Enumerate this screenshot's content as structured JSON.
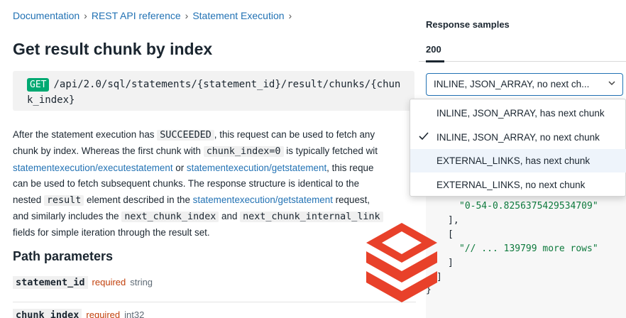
{
  "breadcrumb": {
    "items": [
      "Documentation",
      "REST API reference",
      "Statement Execution"
    ],
    "separator": "›"
  },
  "page": {
    "title": "Get result chunk by index"
  },
  "endpoint": {
    "method": "GET",
    "path_line1": "/api/2.0/sql/statements/{statement_id}/result/chunks/{chun",
    "path_line2": "k_index}"
  },
  "description": {
    "l1a": "After the statement execution has ",
    "l1code": "SUCCEEDED",
    "l1b": ", this request can be used to fetch any",
    "l2a": "chunk by index. Whereas the first chunk with ",
    "l2code": "chunk_index=0",
    "l2b": " is typically fetched wit",
    "l3link1": "statementexecution/executestatement",
    "l3a": " or ",
    "l3link2": "statementexecution/getstatement",
    "l3b": ", this reque",
    "l4": "can be used to fetch subsequent chunks. The response structure is identical to the",
    "l5a": "nested ",
    "l5code": "result",
    "l5b": " element described in the ",
    "l5link": "statementexecution/getstatement",
    "l5c": " request,",
    "l6a": "and similarly includes the ",
    "l6code1": "next_chunk_index",
    "l6b": " and ",
    "l6code2": "next_chunk_internal_link",
    "l7": "fields for simple iteration through the result set."
  },
  "path_params": {
    "title": "Path parameters",
    "params": [
      {
        "name": "statement_id",
        "required": "required",
        "type": "string"
      },
      {
        "name": "chunk_index",
        "required": "required",
        "type": "int32"
      }
    ]
  },
  "response": {
    "title": "Response samples",
    "tab": "200",
    "selected": "INLINE, JSON_ARRAY, no next ch...",
    "options": [
      {
        "label": "INLINE, JSON_ARRAY, has next chunk",
        "checked": false
      },
      {
        "label": "INLINE, JSON_ARRAY, no next chunk",
        "checked": true
      },
      {
        "label": "EXTERNAL_LINKS, has next chunk",
        "checked": false
      },
      {
        "label": "EXTERNAL_LINKS, no next chunk",
        "checked": false
      }
    ],
    "code": {
      "l1": "\"0-54-0.8256375429534709\"",
      "l2": "],",
      "l3": "[",
      "l4": "\"// ... 139799 more rows\"",
      "l5": "]",
      "l6": "]",
      "l7": "}"
    }
  },
  "icons": {
    "chevron": "chevron-down-icon",
    "check": "checkmark-icon",
    "logo": "databricks-logo-icon"
  },
  "colors": {
    "link": "#2272b4",
    "get_badge": "#00a972",
    "required": "#c2410c",
    "logo": "#e8412a"
  }
}
